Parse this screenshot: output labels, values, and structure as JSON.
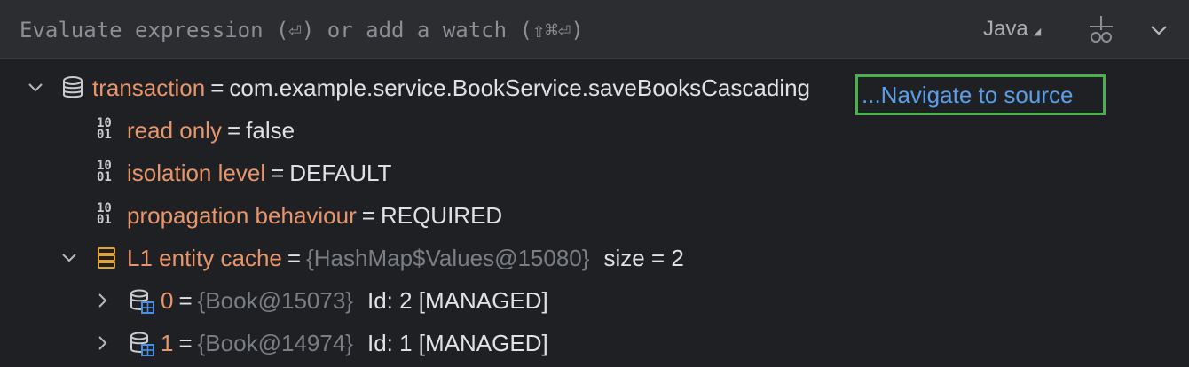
{
  "toolbar": {
    "placeholder": "Evaluate expression (⏎) or add a watch (⇧⌘⏎)",
    "language": "Java"
  },
  "tree": {
    "transaction": {
      "name": "transaction",
      "eq": "=",
      "value": "com.example.service.BookService.saveBooksCascading",
      "link": "...Navigate to source"
    },
    "read_only": {
      "name": "read only",
      "eq": "=",
      "value": "false",
      "icon_text": "10\n01"
    },
    "isolation": {
      "name": "isolation level",
      "eq": "=",
      "value": "DEFAULT",
      "icon_text": "10\n01"
    },
    "propagation": {
      "name": "propagation behaviour",
      "eq": "=",
      "value": "REQUIRED",
      "icon_text": "10\n01"
    },
    "cache": {
      "name": "L1 entity cache",
      "eq": "=",
      "ref": "{HashMap$Values@15080}",
      "value": "size = 2"
    },
    "items": [
      {
        "name": "0",
        "eq": "=",
        "ref": "{Book@15073}",
        "value": "Id: 2 [MANAGED]"
      },
      {
        "name": "1",
        "eq": "=",
        "ref": "{Book@14974}",
        "value": "Id: 1 [MANAGED]"
      }
    ]
  },
  "colors": {
    "background": "#1f2023",
    "toolbar": "#2b2d30",
    "name": "#e8956b",
    "link": "#5a9ee8",
    "highlight": "#4caf50",
    "ref": "#7a7e85"
  },
  "icons": {
    "transaction": "database-icon",
    "binary": "binary-value-icon",
    "cache": "list-stack-icon",
    "entity": "database-table-icon",
    "watch": "add-watch-icon",
    "more": "chevron-down-icon"
  }
}
